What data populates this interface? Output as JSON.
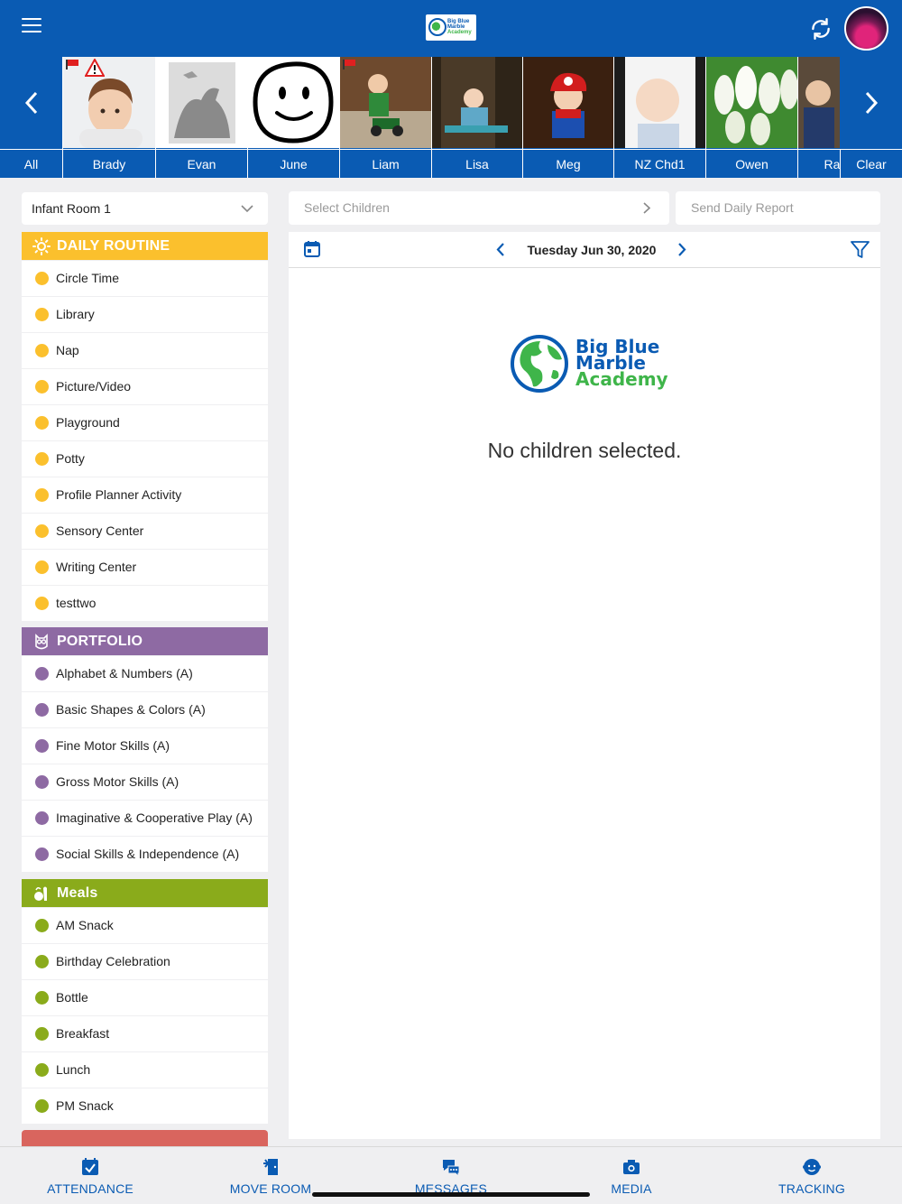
{
  "header": {
    "menu_icon": "hamburger-icon",
    "logo_text": [
      "Big Blue",
      "Marble",
      "Academy"
    ],
    "refresh_icon": "refresh-icon",
    "accent": "#0a5bb3"
  },
  "children_strip": {
    "all_label": "All",
    "clear_label": "Clear",
    "children": [
      {
        "name": "Brady"
      },
      {
        "name": "Evan"
      },
      {
        "name": "June"
      },
      {
        "name": "Liam"
      },
      {
        "name": "Lisa"
      },
      {
        "name": "Meg"
      },
      {
        "name": "NZ Chd1"
      },
      {
        "name": "Owen"
      },
      {
        "name": "Ra"
      }
    ]
  },
  "sidebar": {
    "room": "Infant Room 1",
    "sections": [
      {
        "title": "DAILY ROUTINE",
        "color": "#fbc02d",
        "icon": "sun-icon",
        "items": [
          "Circle Time",
          "Library",
          "Nap",
          "Picture/Video",
          "Playground",
          "Potty",
          "Profile Planner Activity",
          "Sensory Center",
          "Writing Center",
          "testtwo"
        ]
      },
      {
        "title": "PORTFOLIO",
        "color": "#8e6aa3",
        "icon": "owl-icon",
        "items": [
          "Alphabet & Numbers (A)",
          "Basic Shapes & Colors (A)",
          "Fine Motor Skills (A)",
          "Gross Motor Skills (A)",
          "Imaginative & Cooperative Play (A)",
          "Social Skills & Independence (A)"
        ]
      },
      {
        "title": "Meals",
        "color": "#8aab1b",
        "icon": "food-icon",
        "items": [
          "AM Snack",
          "Birthday Celebration",
          "Bottle",
          "Breakfast",
          "Lunch",
          "PM Snack"
        ]
      }
    ]
  },
  "main": {
    "select_children_placeholder": "Select Children",
    "send_report_label": "Send Daily Report",
    "date": "Tuesday Jun 30, 2020",
    "empty_message": "No children selected."
  },
  "tabbar": {
    "tabs": [
      {
        "label": "ATTENDANCE",
        "icon": "calendar-check-icon"
      },
      {
        "label": "MOVE ROOM",
        "icon": "door-icon"
      },
      {
        "label": "MESSAGES",
        "icon": "chat-icon"
      },
      {
        "label": "MEDIA",
        "icon": "camera-icon"
      },
      {
        "label": "TRACKING",
        "icon": "baby-face-icon"
      }
    ]
  }
}
